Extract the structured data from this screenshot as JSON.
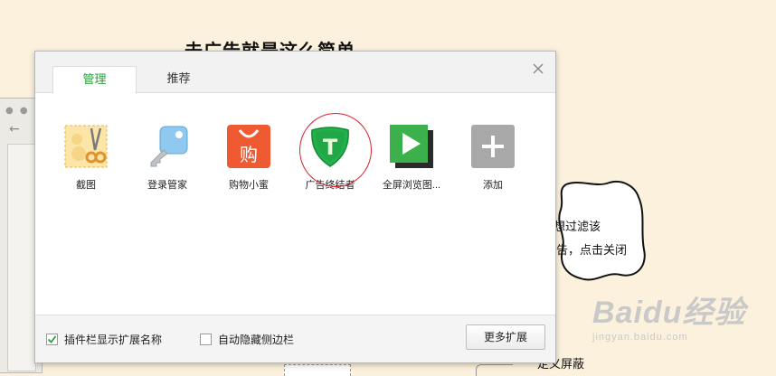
{
  "background": {
    "heading": "去广告就是这么简单……",
    "bubble_lines": [
      "想过滤该",
      "告，点击关闭"
    ],
    "bottom_text": "定义屏蔽",
    "watermark": {
      "logo": "Baidu经验",
      "url": "jingyan.baidu.com"
    }
  },
  "dialog": {
    "tabs": [
      {
        "label": "管理",
        "active": true
      },
      {
        "label": "推荐",
        "active": false
      }
    ],
    "extensions": [
      {
        "label": "截图",
        "icon": "screenshot-icon"
      },
      {
        "label": "登录管家",
        "icon": "key-icon"
      },
      {
        "label": "购物小蜜",
        "icon": "shopping-bag-icon",
        "glyph": "购"
      },
      {
        "label": "广告终结者",
        "icon": "shield-icon",
        "glyph": "T"
      },
      {
        "label": "全屏浏览图...",
        "icon": "play-icon"
      },
      {
        "label": "添加",
        "icon": "plus-icon"
      }
    ],
    "footer": {
      "show_ext_names": {
        "label": "插件栏显示扩展名称",
        "checked": true
      },
      "auto_hide_sidebar": {
        "label": "自动隐藏侧边栏",
        "checked": false
      },
      "more_button": "更多扩展"
    }
  },
  "colors": {
    "accent": "#2a9d3c",
    "highlight_circle": "#d9232d"
  }
}
